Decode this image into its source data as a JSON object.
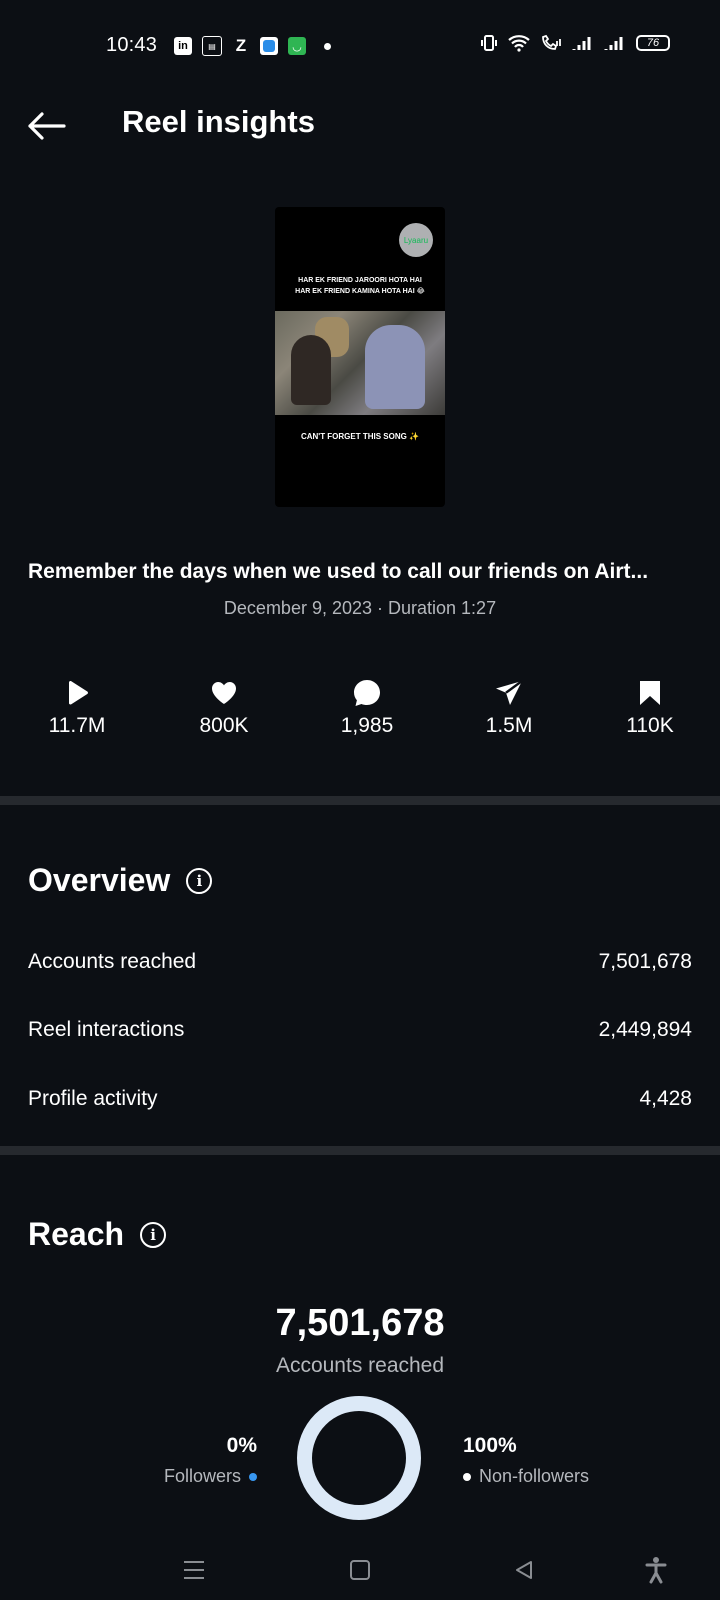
{
  "status_bar": {
    "time": "10:43",
    "left_icons": [
      "linkedin-icon",
      "news-icon",
      "z-icon",
      "app-icon",
      "shopping-icon"
    ],
    "battery": "76"
  },
  "header": {
    "title": "Reel insights"
  },
  "thumbnail": {
    "logo_text": "Lyaaru",
    "caption_top": "HAR EK FRIEND JAROORI HOTA HAI\nHAR EK FRIEND KAMINA HOTA HAI 😂",
    "caption_bottom": "CAN'T FORGET THIS SONG ✨"
  },
  "reel": {
    "caption": "Remember the days when we used to call our friends on Airt...",
    "meta": "December 9, 2023 · Duration 1:27"
  },
  "stats": [
    {
      "icon": "play-icon",
      "value": "11.7M"
    },
    {
      "icon": "heart-icon",
      "value": "800K"
    },
    {
      "icon": "comment-icon",
      "value": "1,985"
    },
    {
      "icon": "share-icon",
      "value": "1.5M"
    },
    {
      "icon": "bookmark-icon",
      "value": "110K"
    }
  ],
  "overview": {
    "title": "Overview",
    "rows": [
      {
        "label": "Accounts reached",
        "value": "7,501,678"
      },
      {
        "label": "Reel interactions",
        "value": "2,449,894"
      },
      {
        "label": "Profile activity",
        "value": "4,428"
      }
    ]
  },
  "reach": {
    "title": "Reach",
    "total": "7,501,678",
    "subtitle": "Accounts reached",
    "followers": {
      "pct": "0%",
      "label": "Followers",
      "color": "#3897f0"
    },
    "non_followers": {
      "pct": "100%",
      "label": "Non-followers",
      "color": "#dce9f7"
    }
  },
  "colors": {
    "background": "#0c0f14",
    "divider": "#26292e",
    "secondary_text": "#b5b8bd"
  }
}
